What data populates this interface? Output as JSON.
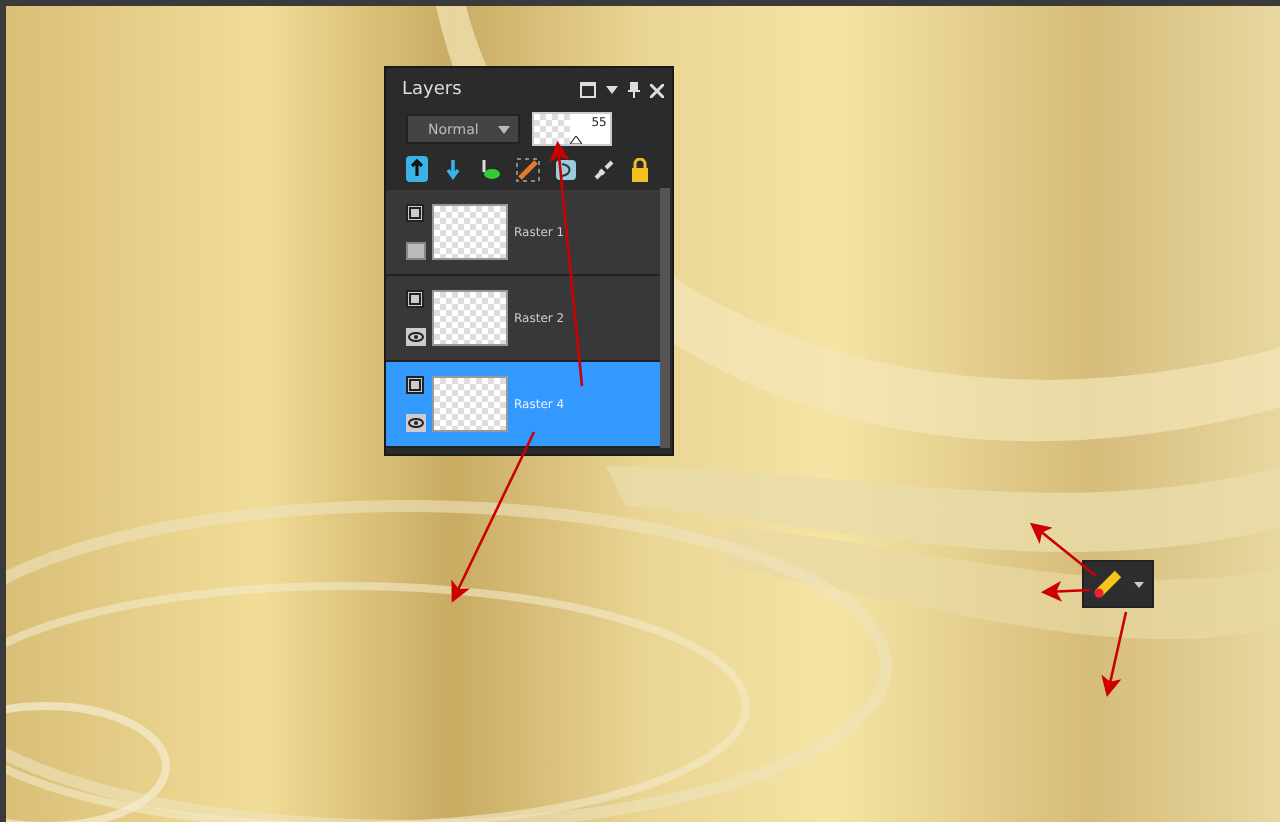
{
  "layers_panel": {
    "title": "Layers",
    "blend_mode": "Normal",
    "opacity": "55",
    "opacity_slider": {
      "level": 0.55
    },
    "layers": [
      {
        "name": "Raster 1",
        "visible": false,
        "selected": false
      },
      {
        "name": "Raster 2",
        "visible": true,
        "selected": false
      },
      {
        "name": "Raster 4",
        "visible": true,
        "selected": true
      }
    ]
  }
}
